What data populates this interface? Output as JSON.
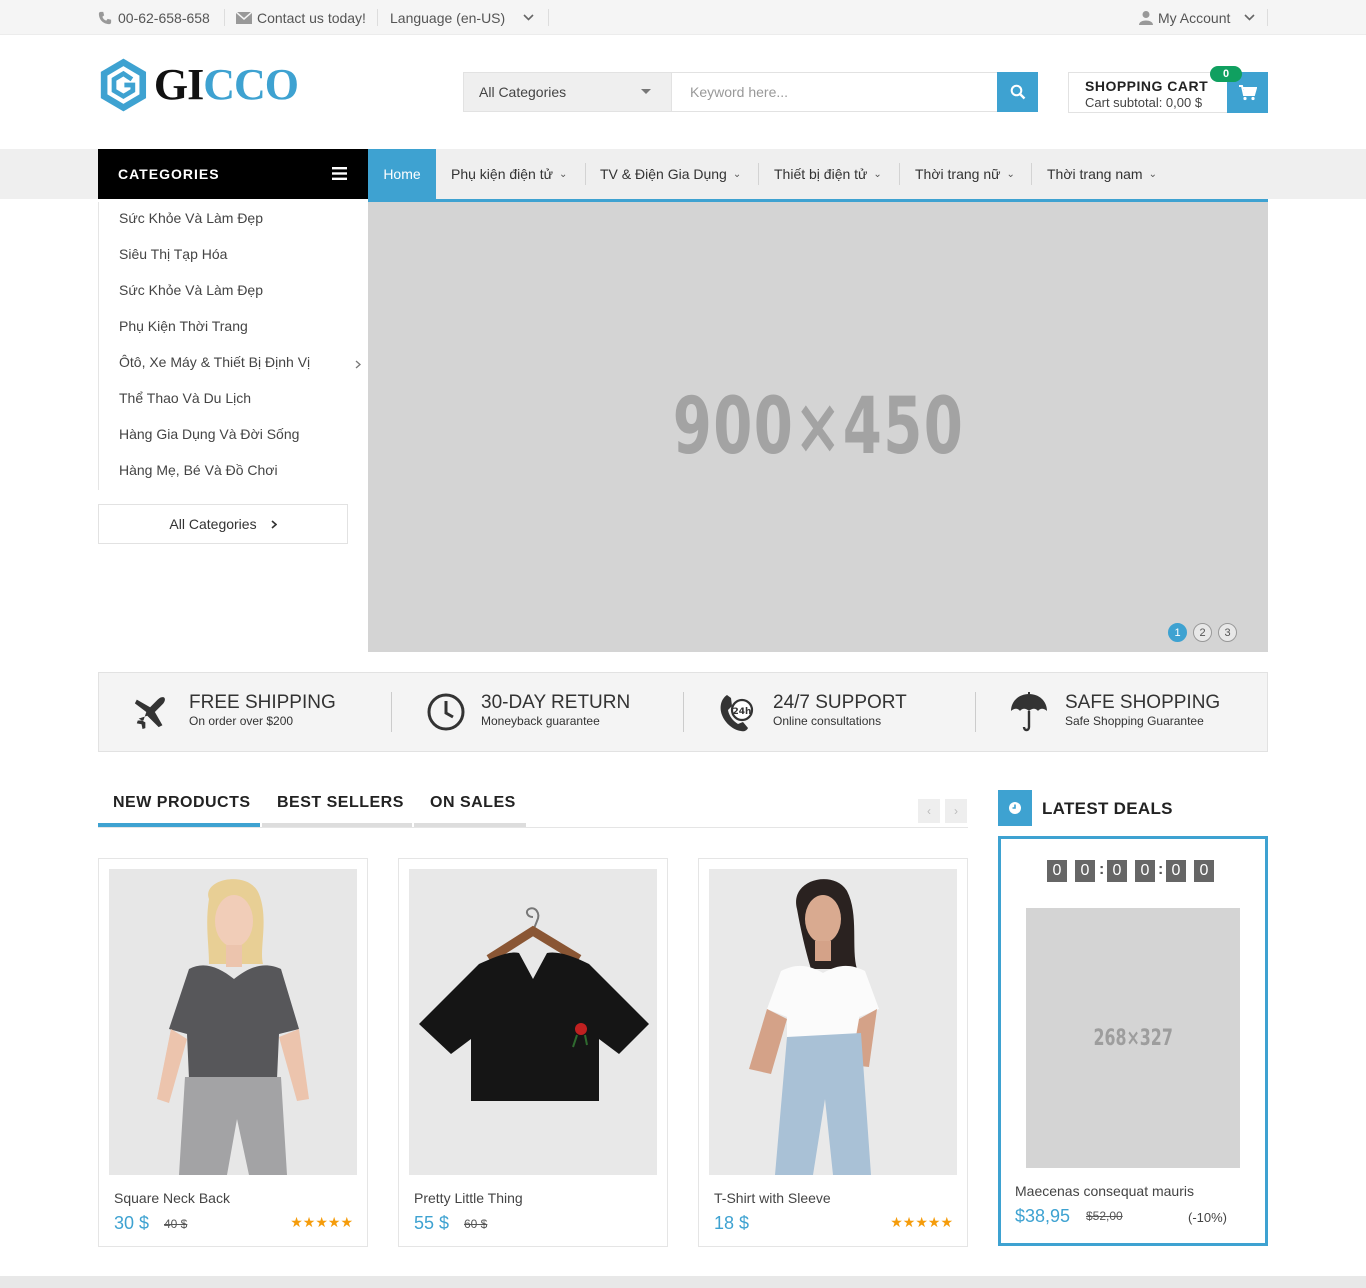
{
  "topbar": {
    "phone": "00-62-658-658",
    "contact": "Contact us today!",
    "language": "Language (en-US)",
    "account": "My Account"
  },
  "header": {
    "logo": {
      "prefix": "GI",
      "suffix": "CCO"
    },
    "search": {
      "category": "All Categories",
      "placeholder": "Keyword here..."
    },
    "cart": {
      "title": "SHOPPING CART",
      "subtotal": "Cart subtotal: 0,00 $",
      "count": "0"
    }
  },
  "nav": {
    "categories_label": "CATEGORIES",
    "items": [
      "Home",
      "Phụ kiện điện tử",
      "TV & Điện Gia Dụng",
      "Thiết bị điện tử",
      "Thời trang nữ",
      "Thời trang nam"
    ]
  },
  "sidebar": {
    "items": [
      "Sức Khỏe Và Làm Đẹp",
      "Siêu Thị Tạp Hóa",
      "Sức Khỏe Và Làm Đẹp",
      "Phụ Kiện Thời Trang",
      "Ôtô, Xe Máy & Thiết Bị Định Vị",
      "Thể Thao Và Du Lịch",
      "Hàng Gia Dụng Và Đời Sống",
      "Hàng Mẹ, Bé Và Đồ Chơi"
    ],
    "all_categories": "All Categories"
  },
  "slider": {
    "placeholder": "900×450",
    "dots": [
      "1",
      "2",
      "3"
    ],
    "active_dot": 1
  },
  "services": [
    {
      "title": "FREE SHIPPING",
      "subtitle": "On order over $200",
      "icon": "airplane-icon"
    },
    {
      "title": "30-DAY RETURN",
      "subtitle": "Moneyback guarantee",
      "icon": "clock-icon"
    },
    {
      "title": "24/7 SUPPORT",
      "subtitle": "Online consultations",
      "icon": "phone-24h-icon"
    },
    {
      "title": "SAFE SHOPPING",
      "subtitle": "Safe Shopping Guarantee",
      "icon": "umbrella-icon"
    }
  ],
  "tabs": [
    "NEW PRODUCTS",
    "BEST SELLERS",
    "ON SALES"
  ],
  "products": [
    {
      "name": "Square Neck Back",
      "price": "30 $",
      "old_price": "40 $",
      "rating": 5,
      "stars": "★★★★★"
    },
    {
      "name": "Pretty Little Thing",
      "price": "55 $",
      "old_price": "60 $"
    },
    {
      "name": "T-Shirt with Sleeve",
      "price": "18 $",
      "rating": 5,
      "stars": "★★★★★"
    }
  ],
  "deals": {
    "title": "LATEST DEALS",
    "timer": [
      "0",
      "0",
      "0",
      "0",
      "0",
      "0"
    ],
    "image_placeholder": "268×327",
    "name": "Maecenas consequat mauris",
    "price": "$38,95",
    "old_price": "$52,00",
    "discount": "(-10%)"
  },
  "colors": {
    "accent": "#3ea2d1",
    "dark": "#000000",
    "star": "#f59c0b",
    "badge": "#10a060"
  }
}
